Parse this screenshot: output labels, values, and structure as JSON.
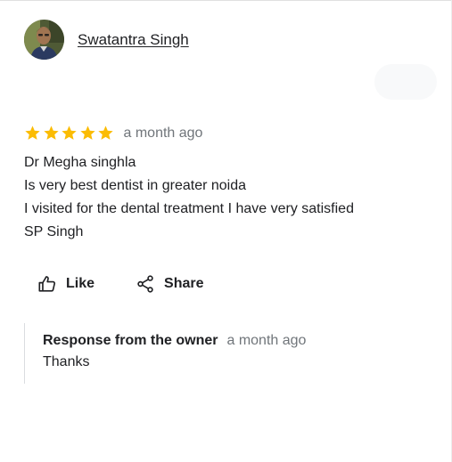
{
  "review": {
    "reviewer": {
      "name": "Swatantra Singh",
      "avatar_icon": "person-photo-avatar"
    },
    "rating": 5,
    "max_rating": 5,
    "star_color": "#fbbc04",
    "date": "a month ago",
    "text_lines": [
      "Dr Megha singhla",
      "Is very best dentist in greater noida",
      "I visited for the dental treatment I have very satisfied",
      "SP Singh"
    ]
  },
  "actions": {
    "like": {
      "label": "Like",
      "icon": "thumbs-up-icon"
    },
    "share": {
      "label": "Share",
      "icon": "share-icon"
    }
  },
  "owner_response": {
    "title": "Response from the owner",
    "date": "a month ago",
    "text": "Thanks"
  }
}
